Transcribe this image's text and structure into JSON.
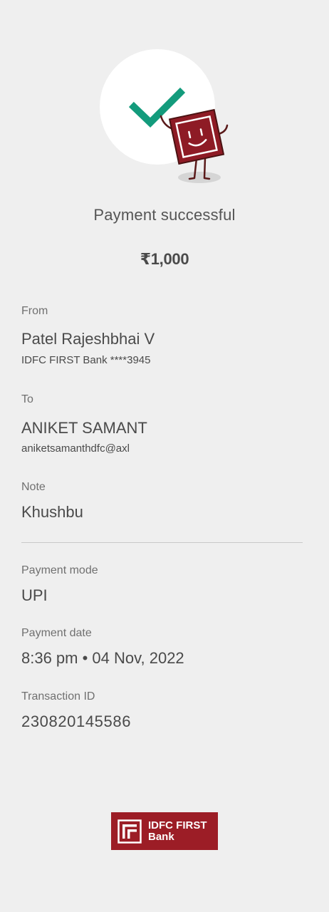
{
  "status": {
    "title": "Payment successful",
    "amount": "₹1,000"
  },
  "from": {
    "label": "From",
    "name": "Patel Rajeshbhai V",
    "account": "IDFC FIRST Bank ****3945"
  },
  "to": {
    "label": "To",
    "name": "ANIKET SAMANT",
    "upi_id": "aniketsamanthdfc@axl"
  },
  "note": {
    "label": "Note",
    "value": "Khushbu"
  },
  "payment_mode": {
    "label": "Payment mode",
    "value": "UPI"
  },
  "payment_date": {
    "label": "Payment date",
    "value": "8:36 pm • 04 Nov, 2022"
  },
  "transaction": {
    "label": "Transaction ID",
    "value": "230820145586"
  },
  "bank": {
    "line1": "IDFC FIRST",
    "line2": "Bank"
  },
  "icons": {
    "hero": "success-check-mascot-icon",
    "logo": "idfc-logo-mark-icon"
  },
  "colors": {
    "background": "#efefef",
    "check": "#139b7c",
    "brand": "#9c1d26",
    "text": "#4a4a4a",
    "label": "#707070"
  }
}
